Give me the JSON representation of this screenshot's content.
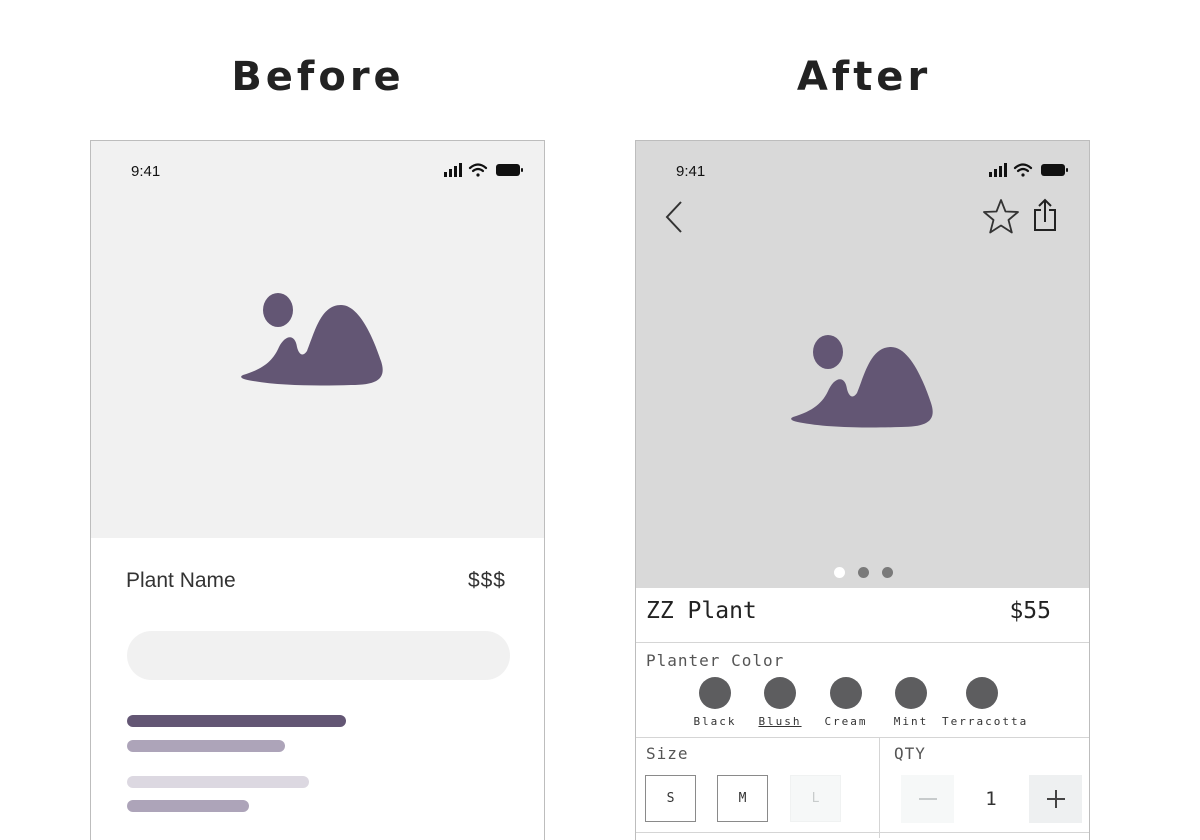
{
  "before": {
    "heading": "Before",
    "status_time": "9:41",
    "product_name": "Plant Name",
    "price": "$$$",
    "icons": {
      "hero": "image-placeholder-icon",
      "signal": "signal-icon",
      "wifi": "wifi-icon",
      "battery": "battery-icon"
    }
  },
  "after": {
    "heading": "After",
    "status_time": "9:41",
    "product_name": "ZZ Plant",
    "price": "$55",
    "carousel": {
      "count": 3,
      "active_index": 0
    },
    "planter_color": {
      "label": "Planter Color",
      "selected": "Blush",
      "options": [
        "Black",
        "Blush",
        "Cream",
        "Mint",
        "Terracotta"
      ]
    },
    "size": {
      "label": "Size",
      "options": [
        "S",
        "M",
        "L"
      ],
      "unavailable": [
        "L"
      ]
    },
    "qty": {
      "label": "QTY",
      "value": "1"
    },
    "icons": {
      "back": "chevron-left-icon",
      "favorite": "star-icon",
      "share": "share-icon",
      "hero": "image-placeholder-icon",
      "minus": "minus-icon",
      "plus": "plus-icon"
    }
  },
  "colors": {
    "accent_purple": "#635674",
    "swatch": "#5d5d5f",
    "hero_before_bg": "#f1f1f1",
    "hero_after_bg": "#d9d9d9"
  }
}
